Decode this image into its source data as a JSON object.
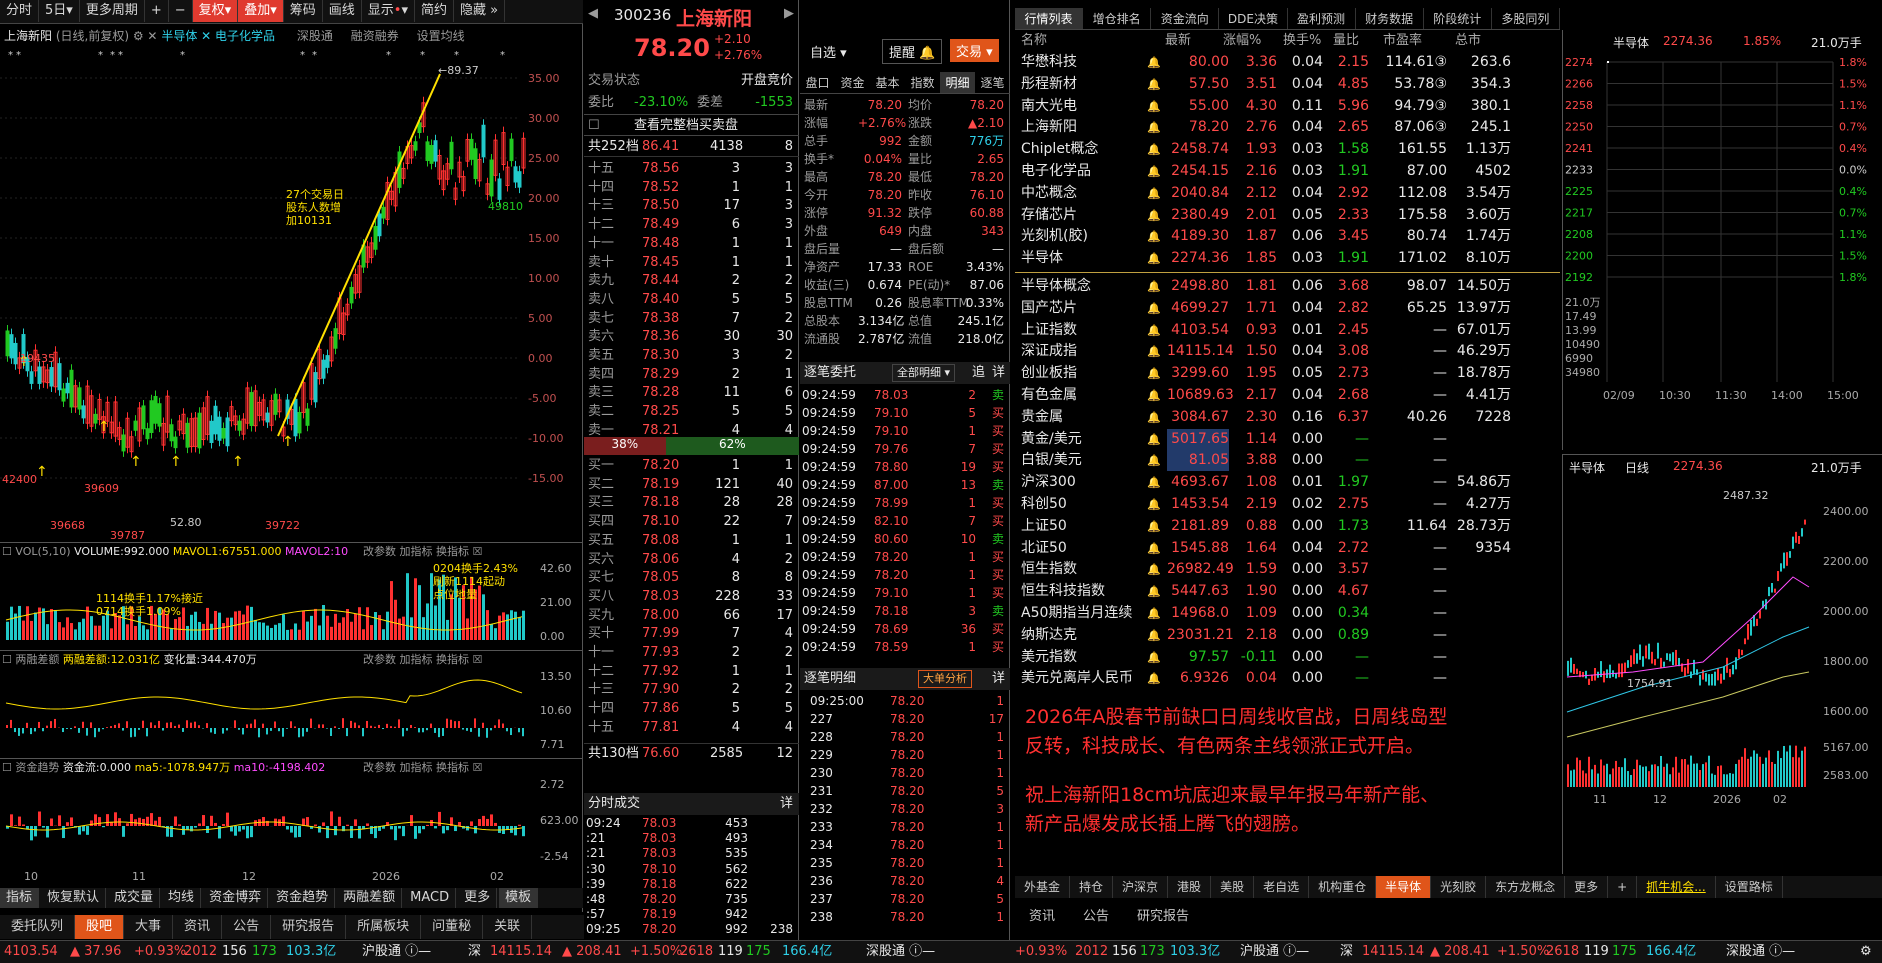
{
  "toolbar": {
    "items": [
      "分时",
      "5日",
      "更多周期",
      "|",
      "+",
      "−",
      "复权",
      "叠加",
      "筹码",
      "画线",
      "显示",
      "简约",
      "隐藏"
    ],
    "active": [
      "复权",
      "叠加"
    ]
  },
  "chart_header": {
    "name": "上海新阳",
    "mode": "(日线,前复权)",
    "tags": [
      "半导体",
      "电子化学品",
      "深股通",
      "融资融券",
      "设置均线"
    ]
  },
  "kline": {
    "price_ticks": [
      "35.00",
      "30.00",
      "25.00",
      "20.00",
      "15.00",
      "10.00",
      "5.00",
      "0.00",
      "-5.00",
      "-10.00",
      "-15.00"
    ],
    "hi_label": "89.37",
    "low_labels": [
      "42400",
      "39609",
      "39668",
      "39722",
      "39787",
      "52.80"
    ],
    "mid_label": "49810",
    "left_label": "19435",
    "annotation": [
      "27个交易日",
      "股东人数增",
      "加10131"
    ]
  },
  "vol": {
    "title": "VOL(5,10)",
    "volume": "VOLUME:992.000",
    "mavol1": "MAVOL1:67551.000",
    "mavol2": "MAVOL2:10",
    "links": [
      "改参数",
      "加指标",
      "换指标"
    ],
    "ticks": [
      "42.60",
      "21.00",
      "0.00"
    ],
    "notes1": [
      "1114换手1.17%接近",
      "0714换手1.09%"
    ],
    "notes2": [
      "0204换手2.43%",
      "刷新1114起动",
      "点位地量"
    ]
  },
  "margin": {
    "title": "两融差额",
    "value": "两融差额:12.031亿",
    "change": "变化量:344.470万",
    "ticks": [
      "13.50",
      "10.60",
      "7.71"
    ]
  },
  "flow": {
    "title": "资金趋势",
    "value": "资金流:0.000",
    "ma5": "ma5:-1078.947万",
    "ma10": "ma10:-4198.402",
    "ticks": [
      "2.72",
      "623.00",
      "-2.54"
    ]
  },
  "x_axis": [
    "10",
    "11",
    "12",
    "2026",
    "02"
  ],
  "bottom_tabs": [
    "指标",
    "恢复默认",
    "成交量",
    "均线",
    "资金博弈",
    "资金趋势",
    "两融差额",
    "MACD",
    "更多",
    "模板"
  ],
  "stock": {
    "code": "300236",
    "name": "上海新阳",
    "price": "78.20",
    "change": "+2.10",
    "pct": "+2.76%",
    "buttons": [
      "自选",
      "提醒",
      "交易"
    ]
  },
  "order_book": {
    "status_label": "交易状态",
    "status": "开盘竞价",
    "ratio_label": "委比",
    "ratio": "-23.10%",
    "diff_label": "委差",
    "diff": "-1553",
    "view_all": "查看完整档买卖盘",
    "sell_total": {
      "label": "共252档",
      "price": "86.41",
      "vol": "4138",
      "n": "8"
    },
    "sells": [
      [
        "十五",
        "78.56",
        "3",
        "3"
      ],
      [
        "十四",
        "78.52",
        "1",
        "1"
      ],
      [
        "十三",
        "78.50",
        "17",
        "3"
      ],
      [
        "十二",
        "78.49",
        "6",
        "3"
      ],
      [
        "十一",
        "78.48",
        "1",
        "1"
      ],
      [
        "卖十",
        "78.45",
        "1",
        "1"
      ],
      [
        "卖九",
        "78.44",
        "2",
        "2"
      ],
      [
        "卖八",
        "78.40",
        "5",
        "5"
      ],
      [
        "卖七",
        "78.38",
        "7",
        "2"
      ],
      [
        "卖六",
        "78.36",
        "30",
        "30"
      ],
      [
        "卖五",
        "78.30",
        "3",
        "2"
      ],
      [
        "卖四",
        "78.29",
        "2",
        "1"
      ],
      [
        "卖三",
        "78.28",
        "11",
        "6"
      ],
      [
        "卖二",
        "78.25",
        "5",
        "5"
      ],
      [
        "卖一",
        "78.21",
        "4",
        "4"
      ]
    ],
    "ratio_bar": [
      "38%",
      "62%"
    ],
    "buys": [
      [
        "买一",
        "78.20",
        "1",
        "1"
      ],
      [
        "买二",
        "78.19",
        "121",
        "40"
      ],
      [
        "买三",
        "78.18",
        "28",
        "28"
      ],
      [
        "买四",
        "78.10",
        "22",
        "7"
      ],
      [
        "买五",
        "78.08",
        "1",
        "1"
      ],
      [
        "买六",
        "78.06",
        "4",
        "2"
      ],
      [
        "买七",
        "78.05",
        "8",
        "8"
      ],
      [
        "买八",
        "78.03",
        "228",
        "33"
      ],
      [
        "买九",
        "78.00",
        "66",
        "17"
      ],
      [
        "买十",
        "77.99",
        "7",
        "4"
      ],
      [
        "十一",
        "77.93",
        "2",
        "2"
      ],
      [
        "十二",
        "77.92",
        "1",
        "1"
      ],
      [
        "十三",
        "77.90",
        "2",
        "2"
      ],
      [
        "十四",
        "77.86",
        "5",
        "5"
      ],
      [
        "十五",
        "77.81",
        "4",
        "4"
      ]
    ],
    "buy_total": {
      "label": "共130档",
      "price": "76.60",
      "vol": "2585",
      "n": "12"
    }
  },
  "ticks_title": "分时成交",
  "ticks_btn": "详",
  "ticks": [
    [
      "09:24",
      "78.03",
      "453"
    ],
    [
      ":21",
      "78.03",
      "493"
    ],
    [
      ":21",
      "78.03",
      "535"
    ],
    [
      ":30",
      "78.10",
      "562"
    ],
    [
      ":39",
      "78.18",
      "622"
    ],
    [
      ":48",
      "78.20",
      "735"
    ],
    [
      ":57",
      "78.19",
      "942"
    ],
    [
      "09:25",
      "78.20",
      "992",
      "238"
    ]
  ],
  "quote_tabs": [
    "盘口",
    "资金",
    "基本",
    "指数",
    "明细",
    "逐笔"
  ],
  "quote": [
    [
      "最新",
      "78.20",
      "均价",
      "78.20"
    ],
    [
      "涨幅",
      "+2.76%",
      "涨跌",
      "▲2.10"
    ],
    [
      "总手",
      "992",
      "金额",
      "776万"
    ],
    [
      "换手*",
      "0.04%",
      "量比",
      "2.65"
    ],
    [
      "最高",
      "78.20",
      "最低",
      "78.20"
    ],
    [
      "今开",
      "78.20",
      "昨收",
      "76.10"
    ],
    [
      "涨停",
      "91.32",
      "跌停",
      "60.88"
    ],
    [
      "外盘",
      "649",
      "内盘",
      "343"
    ],
    [
      "盘后量",
      "—",
      "盘后额",
      "—"
    ],
    [
      "净资产",
      "17.33",
      "ROE",
      "3.43%"
    ],
    [
      "收益(三)",
      "0.674",
      "PE(动)*",
      "87.06"
    ],
    [
      "股息TTM",
      "0.26",
      "股息率TTM",
      "0.33%"
    ],
    [
      "总股本",
      "3.134亿",
      "总值",
      "245.1亿"
    ],
    [
      "流通股",
      "2.787亿",
      "流值",
      "218.0亿"
    ]
  ],
  "zb": {
    "title": "逐笔委托",
    "filter": "全部明细",
    "btns": [
      "追",
      "详"
    ],
    "rows": [
      [
        "09:24:59",
        "78.03",
        "2",
        "卖"
      ],
      [
        "09:24:59",
        "79.10",
        "5",
        "买"
      ],
      [
        "09:24:59",
        "79.10",
        "1",
        "买"
      ],
      [
        "09:24:59",
        "79.76",
        "7",
        "买"
      ],
      [
        "09:24:59",
        "78.80",
        "19",
        "买"
      ],
      [
        "09:24:59",
        "87.00",
        "13",
        "卖"
      ],
      [
        "09:24:59",
        "78.99",
        "1",
        "买"
      ],
      [
        "09:24:59",
        "82.10",
        "7",
        "买"
      ],
      [
        "09:24:59",
        "80.60",
        "10",
        "卖"
      ],
      [
        "09:24:59",
        "78.20",
        "1",
        "买"
      ],
      [
        "09:24:59",
        "78.20",
        "1",
        "买"
      ],
      [
        "09:24:59",
        "79.10",
        "1",
        "买"
      ],
      [
        "09:24:59",
        "78.18",
        "3",
        "卖"
      ],
      [
        "09:24:59",
        "78.69",
        "36",
        "买"
      ],
      [
        "09:24:59",
        "78.59",
        "1",
        "买"
      ]
    ]
  },
  "zbmx": {
    "title": "逐笔明细",
    "btn": "大单分析",
    "btn2": "详",
    "rows": [
      [
        "09:25:00",
        "78.20",
        "1"
      ],
      [
        "227",
        "78.20",
        "17"
      ],
      [
        "228",
        "78.20",
        "1"
      ],
      [
        "229",
        "78.20",
        "1"
      ],
      [
        "230",
        "78.20",
        "1"
      ],
      [
        "231",
        "78.20",
        "5"
      ],
      [
        "232",
        "78.20",
        "3"
      ],
      [
        "233",
        "78.20",
        "1"
      ],
      [
        "234",
        "78.20",
        "1"
      ],
      [
        "235",
        "78.20",
        "1"
      ],
      [
        "236",
        "78.20",
        "4"
      ],
      [
        "237",
        "78.20",
        "5"
      ],
      [
        "238",
        "78.20",
        "1"
      ]
    ]
  },
  "list_tabs": [
    "行情列表",
    "增仓排名",
    "资金流向",
    "DDE决策",
    "盈利预测",
    "财务数据",
    "阶段统计",
    "多股同列"
  ],
  "list_headers": [
    "名称",
    "最新",
    "涨幅%",
    "换手%",
    "量比",
    "市盈率",
    "总市"
  ],
  "list_rows": [
    [
      "华懋科技",
      "80.00",
      "3.36",
      "0.04",
      "2.15",
      "114.61③",
      "263.6"
    ],
    [
      "彤程新材",
      "57.50",
      "3.51",
      "0.04",
      "4.85",
      "53.78③",
      "354.3"
    ],
    [
      "南大光电",
      "55.00",
      "4.30",
      "0.11",
      "5.96",
      "94.79③",
      "380.1"
    ],
    [
      "上海新阳",
      "78.20",
      "2.76",
      "0.04",
      "2.65",
      "87.06③",
      "245.1"
    ],
    [
      "Chiplet概念",
      "2458.74",
      "1.93",
      "0.03",
      "1.58",
      "161.55",
      "1.13万"
    ],
    [
      "电子化学品",
      "2454.15",
      "2.16",
      "0.03",
      "1.91",
      "87.00",
      "4502"
    ],
    [
      "中芯概念",
      "2040.84",
      "2.12",
      "0.04",
      "2.92",
      "112.08",
      "3.54万"
    ],
    [
      "存储芯片",
      "2380.49",
      "2.01",
      "0.05",
      "2.33",
      "175.58",
      "3.60万"
    ],
    [
      "光刻机(胶)",
      "4189.30",
      "1.87",
      "0.06",
      "3.45",
      "80.74",
      "1.74万"
    ],
    [
      "半导体",
      "2274.36",
      "1.85",
      "0.03",
      "1.91",
      "171.02",
      "8.10万"
    ],
    [
      "半导体概念",
      "2498.80",
      "1.81",
      "0.06",
      "3.68",
      "98.07",
      "14.50万"
    ],
    [
      "国产芯片",
      "4699.27",
      "1.71",
      "0.04",
      "2.82",
      "65.25",
      "13.97万"
    ],
    [
      "上证指数",
      "4103.54",
      "0.93",
      "0.01",
      "2.45",
      "—",
      "67.01万"
    ],
    [
      "深证成指",
      "14115.14",
      "1.50",
      "0.04",
      "3.08",
      "—",
      "46.29万"
    ],
    [
      "创业板指",
      "3299.60",
      "1.95",
      "0.05",
      "2.73",
      "—",
      "18.78万"
    ],
    [
      "有色金属",
      "10689.63",
      "2.17",
      "0.04",
      "2.68",
      "—",
      "4.41万"
    ],
    [
      "贵金属",
      "3084.67",
      "2.30",
      "0.16",
      "6.37",
      "40.26",
      "7228"
    ],
    [
      "黄金/美元",
      "5017.65",
      "1.14",
      "0.00",
      "—",
      "—",
      ""
    ],
    [
      "白银/美元",
      "81.05",
      "3.88",
      "0.00",
      "—",
      "—",
      ""
    ],
    [
      "沪深300",
      "4693.67",
      "1.08",
      "0.01",
      "1.97",
      "—",
      "54.86万"
    ],
    [
      "科创50",
      "1453.54",
      "2.19",
      "0.02",
      "2.75",
      "—",
      "4.27万"
    ],
    [
      "上证50",
      "2181.89",
      "0.88",
      "0.00",
      "1.73",
      "11.64",
      "28.73万"
    ],
    [
      "北证50",
      "1545.88",
      "1.64",
      "0.04",
      "2.72",
      "—",
      "9354"
    ],
    [
      "恒生指数",
      "26982.49",
      "1.59",
      "0.00",
      "3.57",
      "—",
      ""
    ],
    [
      "恒生科技指数",
      "5447.63",
      "1.90",
      "0.00",
      "4.67",
      "—",
      ""
    ],
    [
      "A50期指当月连续",
      "14968.0",
      "1.09",
      "0.00",
      "0.34",
      "—",
      ""
    ],
    [
      "纳斯达克",
      "23031.21",
      "2.18",
      "0.00",
      "0.89",
      "—",
      ""
    ],
    [
      "美元指数",
      "97.57",
      "-0.11",
      "0.00",
      "—",
      "—",
      ""
    ],
    [
      "美元兑离岸人民币",
      "6.9326",
      "0.04",
      "0.00",
      "—",
      "—",
      ""
    ]
  ],
  "commentary": [
    "2026年A股春节前缺口日周线收官战，日周线岛型",
    "反转，科技成长、有色两条主线领涨正式开启。",
    "",
    "祝上海新阳18cm坑底迎来最早年报马年新产能、",
    "新产品爆发成长插上腾飞的翅膀。"
  ],
  "list_tabs_bottom": [
    "外基金",
    "持仓",
    "沪深京",
    "港股",
    "美股",
    "老自选",
    "机构重仓",
    "半导体",
    "光刻胶",
    "东方龙概念",
    "更多",
    "+",
    "抓牛机会...",
    "设置路标"
  ],
  "mini_intraday": {
    "title": "半导体",
    "price": "2274.36",
    "pct": "1.85%",
    "vol": "21.0万手",
    "left_ticks": [
      "2274",
      "2266",
      "2258",
      "2250",
      "2241",
      "2233",
      "2225",
      "2217",
      "2208",
      "2200",
      "2192"
    ],
    "right_ticks": [
      "1.8%",
      "1.5%",
      "1.1%",
      "0.7%",
      "0.4%",
      "0.0%",
      "0.4%",
      "0.7%",
      "1.1%",
      "1.5%",
      "1.8%"
    ],
    "vol_ticks": [
      "21.0万",
      "17.49",
      "13.99",
      "10490",
      "6990",
      "34980"
    ],
    "times": [
      "02/09",
      "10:30",
      "11:30",
      "14:00",
      "15:00"
    ]
  },
  "mini_daily": {
    "title": "半导体",
    "period": "日线",
    "price": "2274.36",
    "vol": "21.0万手",
    "hi": "2487.32",
    "low": "1754.91",
    "ticks": [
      "2400.00",
      "2200.00",
      "2000.00",
      "1800.00",
      "1600.00"
    ],
    "vol_ticks": [
      "5167.00",
      "2583.00"
    ],
    "x": [
      "11",
      "12",
      "2026",
      "02"
    ]
  },
  "bottom_nav": [
    "委托队列",
    "股吧",
    "大事",
    "资讯",
    "公告",
    "研究报告",
    "所属板块",
    "问董秘",
    "关联"
  ],
  "right_nav": [
    "资讯",
    "公告",
    "研究报告"
  ],
  "status_bar": {
    "sh": "4103.54",
    "sh_chg": "▲ 37.96",
    "sh_pct": "+0.93%",
    "sh_n": "2012",
    "sh_d": "156",
    "sh_f": "173",
    "sh_amt": "103.3亿",
    "hgt": "沪股通",
    "sz": "14115.14",
    "sz_chg": "▲ 208.41",
    "sz_pct": "+1.50%",
    "sz_n": "2618",
    "sz_d": "119",
    "sz_f": "175",
    "sz_amt": "166.4亿",
    "sgt": "深股通"
  }
}
